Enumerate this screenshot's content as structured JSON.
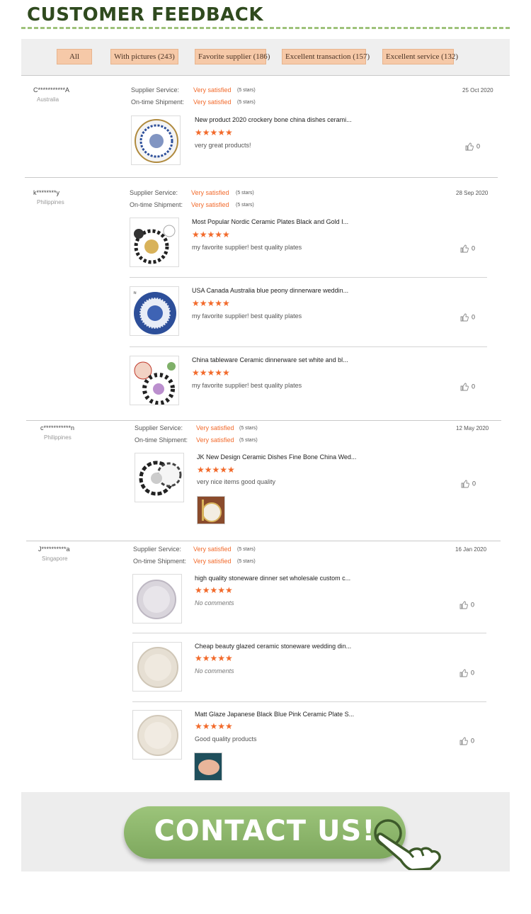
{
  "header": {
    "title": "CUSTOMER FEEDBACK"
  },
  "filters": [
    {
      "label": "All"
    },
    {
      "label": "With pictures (243)"
    },
    {
      "label": "Favorite supplier (186)"
    },
    {
      "label": "Excellent transaction (157)"
    },
    {
      "label": "Excellent service (132)"
    }
  ],
  "rating_labels": {
    "supplier": "Supplier Service:",
    "shipment": "On-time Shipment:",
    "value": "Very satisfied",
    "stars": "(5 stars)"
  },
  "reviews": [
    {
      "user": "C***********A",
      "country": "Australia",
      "date": "25 Oct 2020",
      "items": [
        {
          "title": "New product 2020 crockery bone china dishes cerami...",
          "stars": "★★★★★",
          "comment": "very great products!",
          "likes": "0"
        }
      ]
    },
    {
      "user": "k********y",
      "country": "Philippines",
      "date": "28 Sep 2020",
      "items": [
        {
          "title": "Most Popular Nordic Ceramic Plates Black and Gold I...",
          "stars": "★★★★★",
          "comment": "my favorite supplier! best quality plates",
          "likes": "0"
        },
        {
          "title": "USA Canada Australia blue peony dinnerware weddin...",
          "stars": "★★★★★",
          "comment": "my favorite supplier! best quality plates",
          "likes": "0"
        },
        {
          "title": "China tableware Ceramic dinnerware set white and bl...",
          "stars": "★★★★★",
          "comment": "my favorite supplier! best quality plates",
          "likes": "0"
        }
      ]
    },
    {
      "user": "c***********n",
      "country": "Philippines",
      "date": "12 May 2020",
      "items": [
        {
          "title": "JK New Design Ceramic Dishes Fine Bone China Wed...",
          "stars": "★★★★★",
          "comment": "very nice items good quality",
          "likes": "0"
        }
      ]
    },
    {
      "user": "J**********a",
      "country": "Singapore",
      "date": "16 Jan 2020",
      "items": [
        {
          "title": "high quality stoneware dinner set wholesale custom c...",
          "stars": "★★★★★",
          "comment": "No comments",
          "likes": "0"
        },
        {
          "title": "Cheap beauty glazed ceramic stoneware wedding din...",
          "stars": "★★★★★",
          "comment": "No comments",
          "likes": "0"
        },
        {
          "title": "Matt Glaze Japanese Black Blue Pink Ceramic Plate S...",
          "stars": "★★★★★",
          "comment": "Good quality products",
          "likes": "0"
        }
      ]
    }
  ],
  "contact": {
    "label": "CONTACT US!"
  },
  "colors": {
    "accent_orange": "#f26a2b",
    "chip_bg": "#f6c9a8",
    "header_green": "#2f4a1e",
    "button_green": "#8ab66a"
  }
}
